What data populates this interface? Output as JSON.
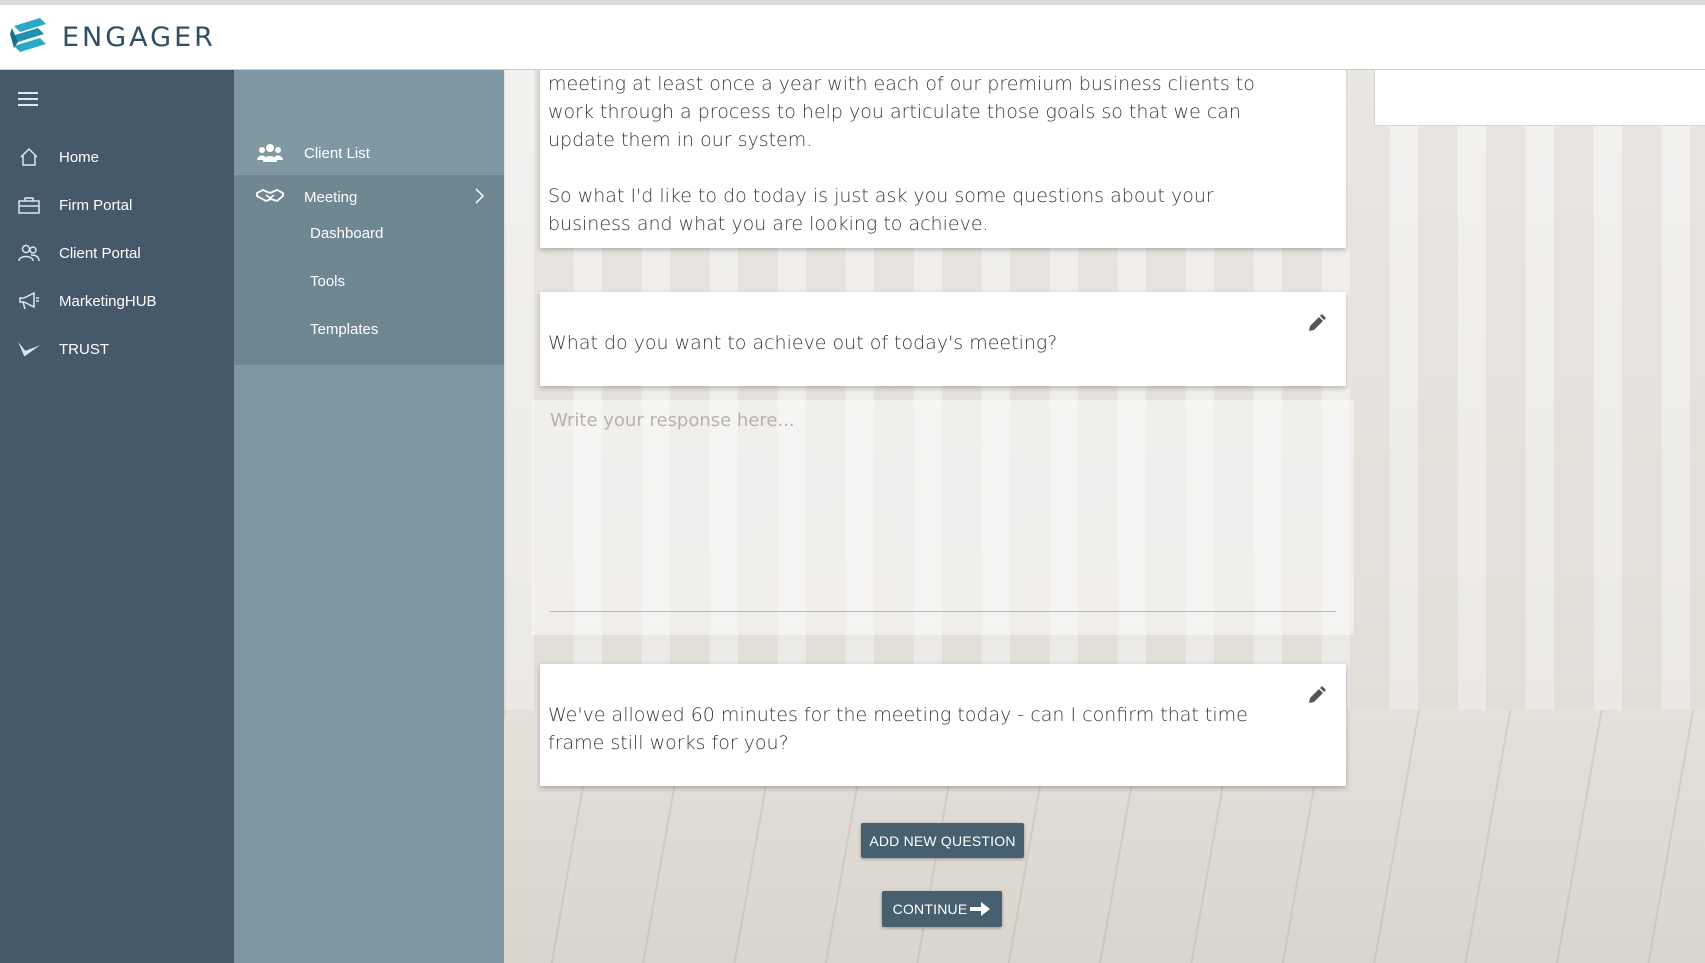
{
  "header": {
    "brand": "ENGAGER",
    "colors": {
      "brand": "#2f4f63",
      "logo_accent": "#2aa7c9"
    }
  },
  "sidebar": {
    "menu_icon": "hamburger-icon",
    "items": [
      {
        "label": "Home",
        "icon": "home-icon"
      },
      {
        "label": "Firm Portal",
        "icon": "briefcase-icon"
      },
      {
        "label": "Client Portal",
        "icon": "users-icon"
      },
      {
        "label": "MarketingHUB",
        "icon": "megaphone-icon"
      },
      {
        "label": "TRUST",
        "icon": "trust-check-icon"
      }
    ]
  },
  "subnav": {
    "client_list": "Client List",
    "meeting": "Meeting",
    "children": [
      "Dashboard",
      "Tools",
      "Templates"
    ]
  },
  "main": {
    "intro_card": {
      "text_1": "meeting at least once a year with each of our premium business clients to work through a process to help you articulate those goals so that we can update them in our system.",
      "text_2": "So what I'd like to do today is just ask you some questions about your business and what you are looking to achieve."
    },
    "question_1": "What do you want to achieve out of today's meeting?",
    "response_placeholder": "Write your response here...",
    "question_2": "We've allowed 60 minutes for the meeting today - can I confirm that time frame still works for you?",
    "add_question_label": "ADD NEW QUESTION",
    "continue_label": "CONTINUE"
  }
}
